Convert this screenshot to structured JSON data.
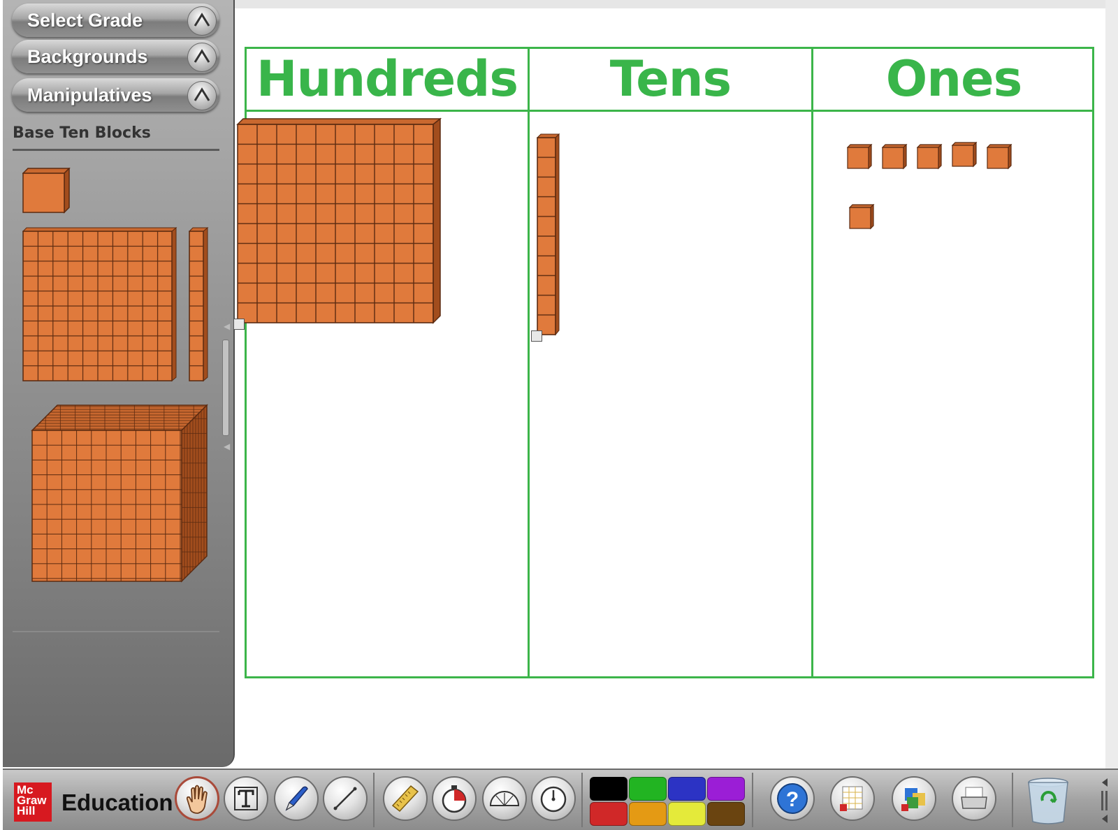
{
  "sidebar": {
    "menus": [
      {
        "label": "Select Grade"
      },
      {
        "label": "Backgrounds"
      },
      {
        "label": "Manipulatives"
      }
    ],
    "section_title": "Base Ten Blocks",
    "palette": [
      "unit cube",
      "flat",
      "rod",
      "thousand cube"
    ]
  },
  "chart": {
    "columns": [
      "Hundreds",
      "Tens",
      "Ones"
    ],
    "placed_blocks": {
      "hundreds": 1,
      "tens": 1,
      "ones": 6
    }
  },
  "toolbar": {
    "brand_logo": "Mc Graw Hill",
    "brand_text": "Education",
    "tools": [
      "hand-icon",
      "text-icon",
      "pen-icon",
      "line-icon"
    ],
    "measure_tools": [
      "ruler-icon",
      "timer-icon",
      "protractor-icon",
      "stopwatch-icon"
    ],
    "colors": [
      "#000000",
      "#22b422",
      "#2c33c4",
      "#9b1ed6",
      "#d02828",
      "#e49a14",
      "#e4ea3a",
      "#6a4410"
    ],
    "actions": [
      "help-icon",
      "clear-background-icon",
      "clear-manipulatives-icon",
      "print-icon",
      "trash-icon"
    ]
  },
  "colors": {
    "block_fill": "#e07a3c",
    "block_edge": "#5b2a10",
    "chart_green": "#3cb54a"
  }
}
